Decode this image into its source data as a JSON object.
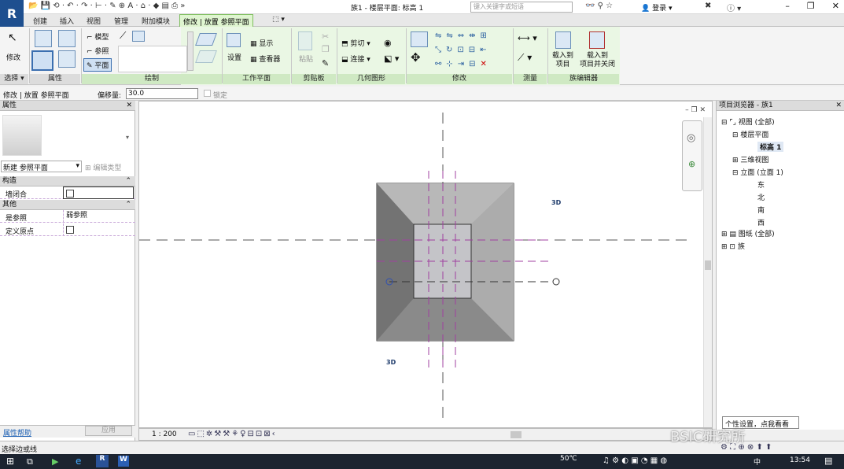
{
  "app": {
    "logo": "R",
    "doc_title": "族1 - 楼层平面: 标高 1",
    "search_placeholder": "键入关键字或短语",
    "login_label": "登录"
  },
  "tabs": [
    "创建",
    "插入",
    "视图",
    "管理",
    "附加模块",
    "修改 | 放置 参照平面"
  ],
  "ribbon": {
    "select": {
      "modify": "修改",
      "panel": "选择 ▾"
    },
    "properties": {
      "panel": "属性"
    },
    "draw": {
      "line": "线",
      "pick": "拾取线",
      "label_model": "模型",
      "label_ref": "参照",
      "label_plane": "平面",
      "panel": "绘制"
    },
    "workplane": {
      "set": "设置",
      "show": "显示",
      "viewer": "查看器",
      "panel": "工作平面"
    },
    "clipboard": {
      "paste": "粘贴",
      "panel": "剪贴板"
    },
    "geometry": {
      "cut": "剪切",
      "join": "连接",
      "panel": "几何图形"
    },
    "modify": {
      "panel": "修改"
    },
    "measure": {
      "panel": "测量"
    },
    "family_editor": {
      "load_project": "载入到\n项目",
      "load_close": "载入到\n项目并关闭",
      "panel": "族编辑器"
    }
  },
  "options_bar": {
    "context": "修改 | 放置 参照平面",
    "offset_label": "偏移量:",
    "offset_value": "30.0",
    "lock_label": "锁定"
  },
  "properties": {
    "title": "属性",
    "type_selector": "新建 参照平面",
    "edit_type": "编辑类型",
    "groups": [
      {
        "name": "构造",
        "rows": [
          {
            "key": "墙闭合",
            "value": ""
          }
        ]
      },
      {
        "name": "其他",
        "rows": [
          {
            "key": "是参照",
            "value": "弱参照"
          },
          {
            "key": "定义原点",
            "value": ""
          }
        ]
      }
    ],
    "help_link": "属性帮助",
    "apply": "应用"
  },
  "canvas": {
    "label_3d_a": "3D",
    "label_3d_b": "3D"
  },
  "view_control": {
    "scale": "1 : 200"
  },
  "browser": {
    "title": "项目浏览器 - 族1",
    "items": [
      "视图 (全部)",
      "楼层平面",
      "标高 1",
      "三维视图",
      "立面 (立面 1)",
      "东",
      "北",
      "南",
      "西",
      "图纸 (全部)",
      "族"
    ]
  },
  "status": {
    "text": "选择边或线",
    "tooltip": "个性设置，点我看看",
    "watermark": "BSIC研究所"
  },
  "taskbar": {
    "temperature": "50℃",
    "ime": "中",
    "time": "13:54"
  }
}
